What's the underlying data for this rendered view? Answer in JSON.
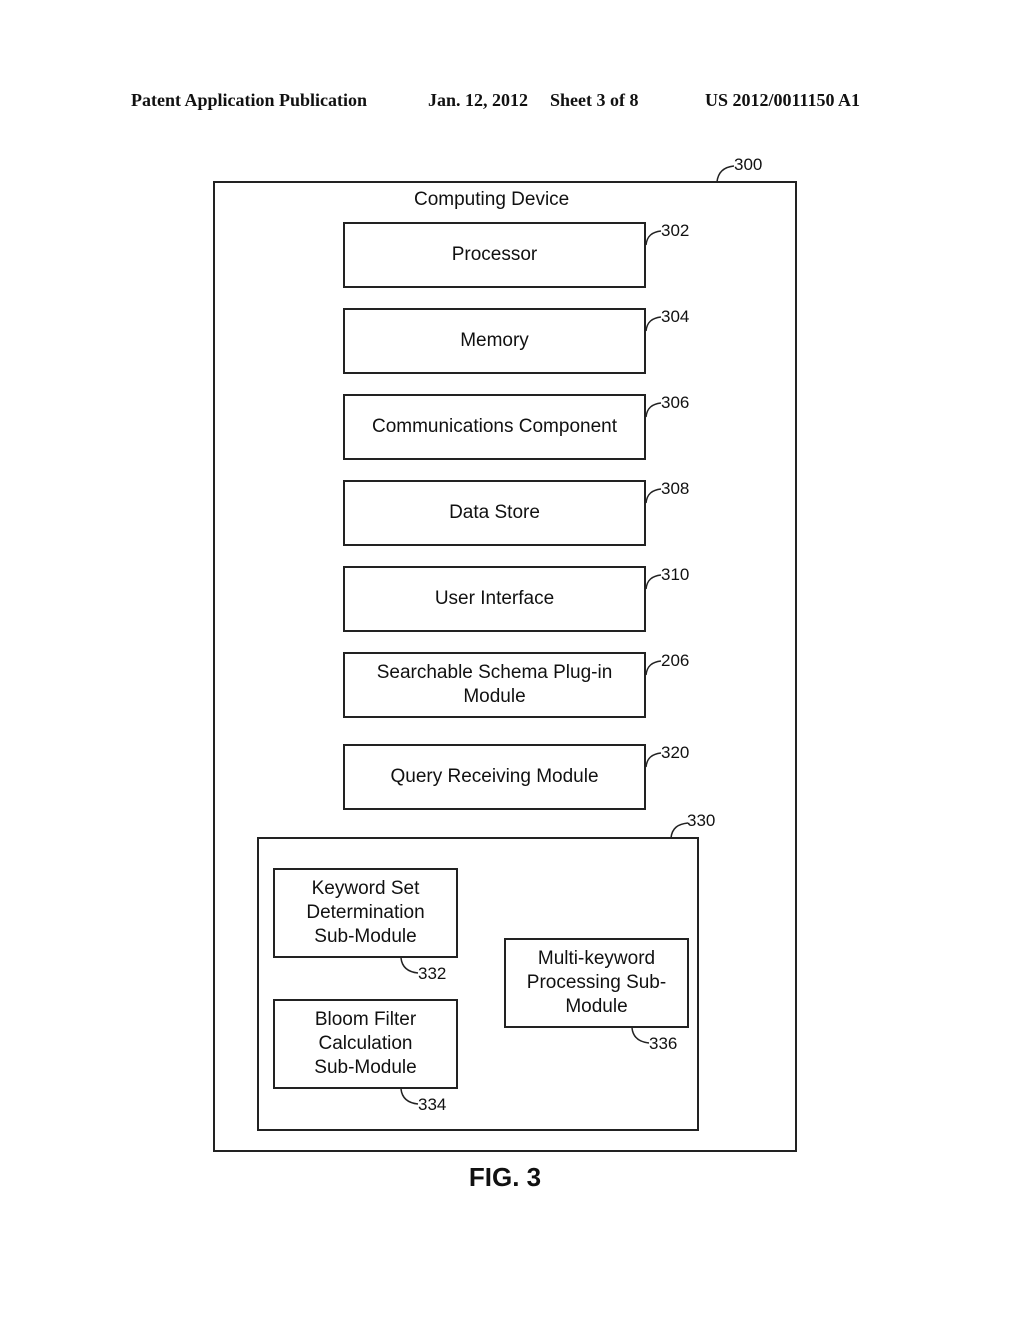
{
  "header": {
    "publication": "Patent Application Publication",
    "date": "Jan. 12, 2012",
    "sheet": "Sheet 3 of 8",
    "number": "US 2012/0011150 A1"
  },
  "device": {
    "label": "Computing Device",
    "ref": "300"
  },
  "components": [
    {
      "label": "Processor",
      "ref": "302"
    },
    {
      "label": "Memory",
      "ref": "304"
    },
    {
      "label": "Communications Component",
      "ref": "306"
    },
    {
      "label": "Data Store",
      "ref": "308"
    },
    {
      "label": "User Interface",
      "ref": "310"
    },
    {
      "label": "Searchable Schema Plug-in Module",
      "ref": "206"
    },
    {
      "label": "Query Receiving Module",
      "ref": "320"
    }
  ],
  "module_group": {
    "ref": "330",
    "submodules": [
      {
        "label": "Keyword Set Determination Sub-Module",
        "ref": "332"
      },
      {
        "label": "Bloom Filter Calculation Sub-Module",
        "ref": "334"
      },
      {
        "label": "Multi-keyword Processing Sub-Module",
        "ref": "336"
      }
    ]
  },
  "figure_label": "FIG. 3"
}
